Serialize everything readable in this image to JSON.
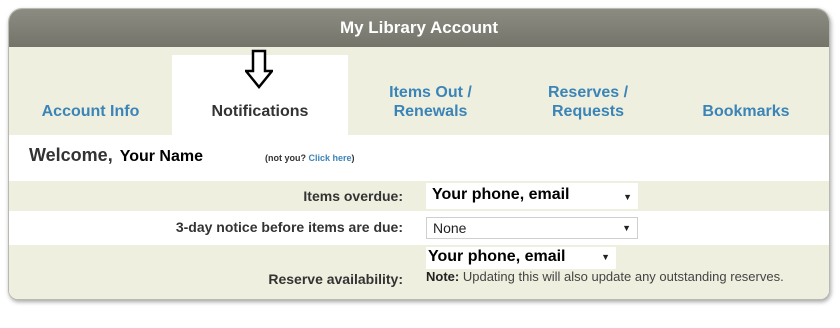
{
  "header": {
    "title": "My Library Account"
  },
  "tabs": [
    {
      "label": "Account Info"
    },
    {
      "label": "Notifications"
    },
    {
      "label": "Items Out / Renewals"
    },
    {
      "label": "Reserves / Requests"
    },
    {
      "label": "Bookmarks"
    }
  ],
  "active_tab": "Notifications",
  "welcome": {
    "prefix": "Welcome,",
    "name": "Your Name",
    "notyou_prefix": "(not you?",
    "click_here": "Click here",
    "notyou_suffix": ")"
  },
  "settings": {
    "overdue_label": "Items overdue:",
    "overdue_value": "Your phone, email",
    "notice_label": "3-day notice before items are due:",
    "notice_value": "None",
    "reserve_label": "Reserve availability:",
    "reserve_value": "Your phone, email",
    "note_bold": "Note:",
    "note_text": "Updating this will also update any outstanding reserves."
  },
  "colors": {
    "accent": "#3b84b7",
    "tabbar": "#efefdf",
    "title": "#7d7d74"
  }
}
